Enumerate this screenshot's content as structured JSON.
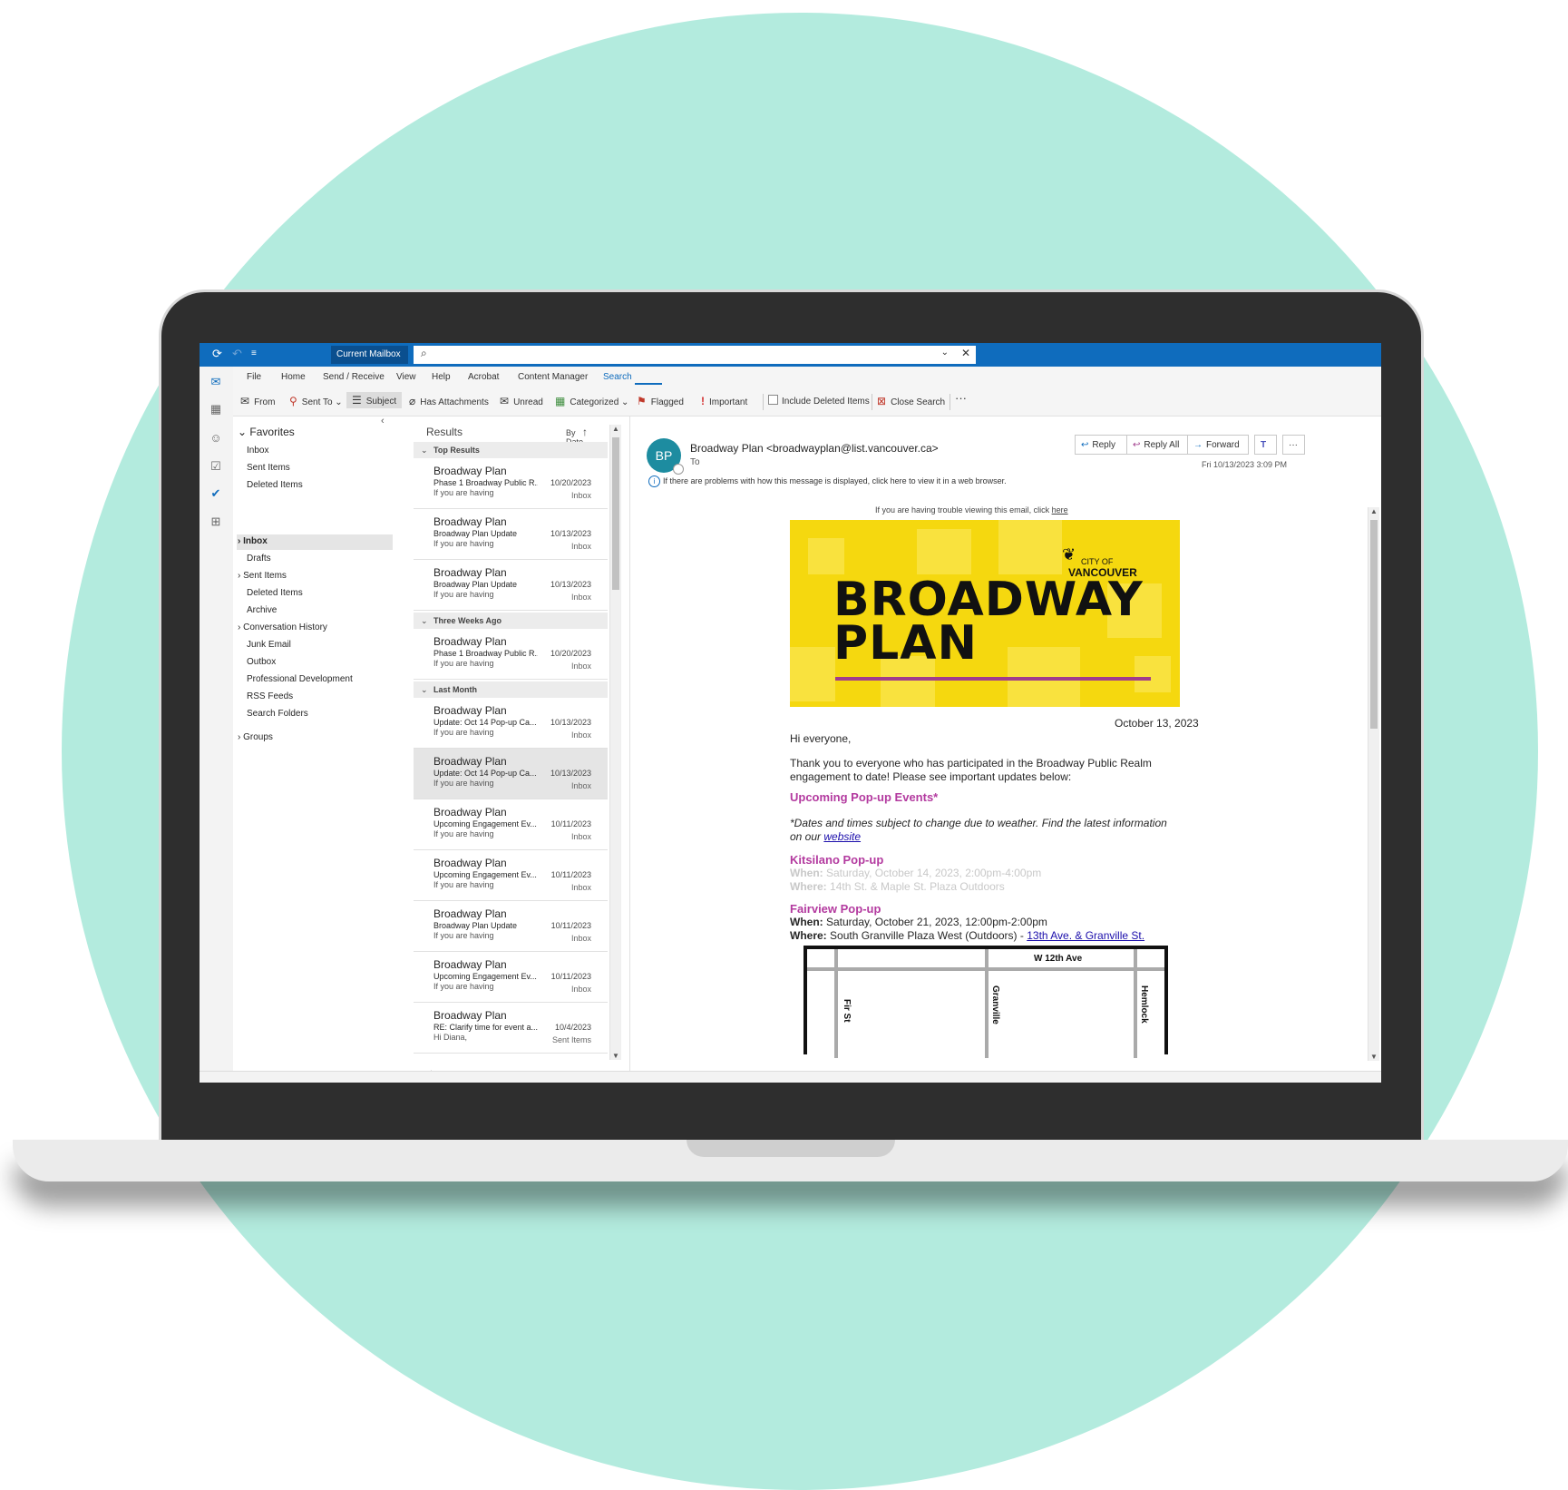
{
  "toolbar_top": {
    "mailbox_scope": "Current Mailbox",
    "search_value": ""
  },
  "ribbon": {
    "tabs": [
      "File",
      "Home",
      "Send / Receive",
      "View",
      "Help",
      "Acrobat",
      "Content Manager",
      "Search"
    ],
    "active_tab": "Search",
    "buttons": {
      "from": "From",
      "sent_to": "Sent To",
      "subject": "Subject",
      "has_attachments": "Has Attachments",
      "unread": "Unread",
      "categorized": "Categorized",
      "flagged": "Flagged",
      "important": "Important",
      "include_deleted": "Include Deleted Items",
      "close_search": "Close Search",
      "more": "···"
    }
  },
  "folders": {
    "favorites_label": "Favorites",
    "favorites": [
      "Inbox",
      "Sent Items",
      "Deleted Items"
    ],
    "mailbox": [
      "Inbox",
      "Drafts",
      "Sent Items",
      "Deleted Items",
      "Archive",
      "Conversation History",
      "Junk Email",
      "Outbox",
      "Professional Development",
      "RSS Feeds",
      "Search Folders"
    ],
    "groups_label": "Groups"
  },
  "message_list": {
    "header": "Results",
    "sort": "By Date",
    "groups": {
      "top": "Top Results",
      "three_weeks": "Three Weeks Ago",
      "last_month": "Last Month"
    },
    "messages": [
      {
        "sender": "Broadway Plan",
        "subject": "Phase 1 Broadway Public R...",
        "preview": "If you are having",
        "date": "10/20/2023",
        "folder": "Inbox"
      },
      {
        "sender": "Broadway Plan",
        "subject": "Broadway Plan Update",
        "preview": "If you are having",
        "date": "10/13/2023",
        "folder": "Inbox"
      },
      {
        "sender": "Broadway Plan",
        "subject": "Broadway Plan Update",
        "preview": "If you are having",
        "date": "10/13/2023",
        "folder": "Inbox"
      },
      {
        "sender": "Broadway Plan",
        "subject": "Phase 1 Broadway Public R...",
        "preview": "If you are having",
        "date": "10/20/2023",
        "folder": "Inbox"
      },
      {
        "sender": "Broadway Plan",
        "subject": "Update: Oct 14 Pop-up Ca...",
        "preview": "If you are having",
        "date": "10/13/2023",
        "folder": "Inbox"
      },
      {
        "sender": "Broadway Plan",
        "subject": "Update: Oct 14 Pop-up Ca...",
        "preview": "If you are having",
        "date": "10/13/2023",
        "folder": "Inbox"
      },
      {
        "sender": "Broadway Plan",
        "subject": "Upcoming Engagement Ev...",
        "preview": "If you are having",
        "date": "10/11/2023",
        "folder": "Inbox"
      },
      {
        "sender": "Broadway Plan",
        "subject": "Upcoming Engagement Ev...",
        "preview": "If you are having",
        "date": "10/11/2023",
        "folder": "Inbox"
      },
      {
        "sender": "Broadway Plan",
        "subject": "Broadway Plan Update",
        "preview": "If you are having",
        "date": "10/11/2023",
        "folder": "Inbox"
      },
      {
        "sender": "Broadway Plan",
        "subject": "Upcoming Engagement Ev...",
        "preview": "If you are having",
        "date": "10/11/2023",
        "folder": "Inbox"
      },
      {
        "sender": "Broadway Plan",
        "subject": "RE: Clarify time for event a...",
        "preview": "Hi Diana,",
        "date": "10/4/2023",
        "folder": "Sent Items"
      }
    ]
  },
  "reading": {
    "avatar": "BP",
    "from": "Broadway Plan <broadwayplan@list.vancouver.ca>",
    "to": "To",
    "info": "If there are problems with how this message is displayed, click here to view it in a web browser.",
    "actions": {
      "reply": "Reply",
      "reply_all": "Reply All",
      "forward": "Forward",
      "more": "···"
    },
    "timestamp": "Fri 10/13/2023 3:09 PM",
    "email": {
      "trouble_text": "If you are having trouble viewing this email, click ",
      "trouble_link": "here",
      "banner_title_1": "BROADWAY",
      "banner_title_2": "PLAN",
      "banner_org_small": "CITY OF",
      "banner_org_big": "VANCOUVER",
      "date": "October 13, 2023",
      "greeting": "Hi everyone,",
      "intro": "Thank you to everyone who has participated in the Broadway Public Realm engagement to date! Please see important updates below:",
      "events_heading": "Upcoming Pop-up Events*",
      "note": "*Dates and times subject to change due to weather. Find the latest information on our ",
      "note_link": "website",
      "kits_heading": "Kitsilano Pop-up",
      "kits_when_label": "When:",
      "kits_when": "Saturday, October 14, 2023, 2:00pm-4:00pm",
      "kits_where_label": "Where:",
      "kits_where": "14th St. & Maple St. Plaza Outdoors",
      "fair_heading": "Fairview Pop-up",
      "fair_when_label": "When:",
      "fair_when": "Saturday, October 21, 2023, 12:00pm-2:00pm",
      "fair_where_label": "Where:",
      "fair_where": "South Granville Plaza West (Outdoors) - ",
      "fair_where_link": "13th Ave. & Granville St.",
      "map_labels": {
        "top": "W 12th Ave",
        "fir": "Fir St",
        "granville": "Granville",
        "hemlock": "Hemlock"
      }
    }
  },
  "colors": {
    "circle": "#b3ebde",
    "accent": "#0f6cbd",
    "banner_yellow": "#f5d80f",
    "section_heading": "#b33a9f"
  }
}
